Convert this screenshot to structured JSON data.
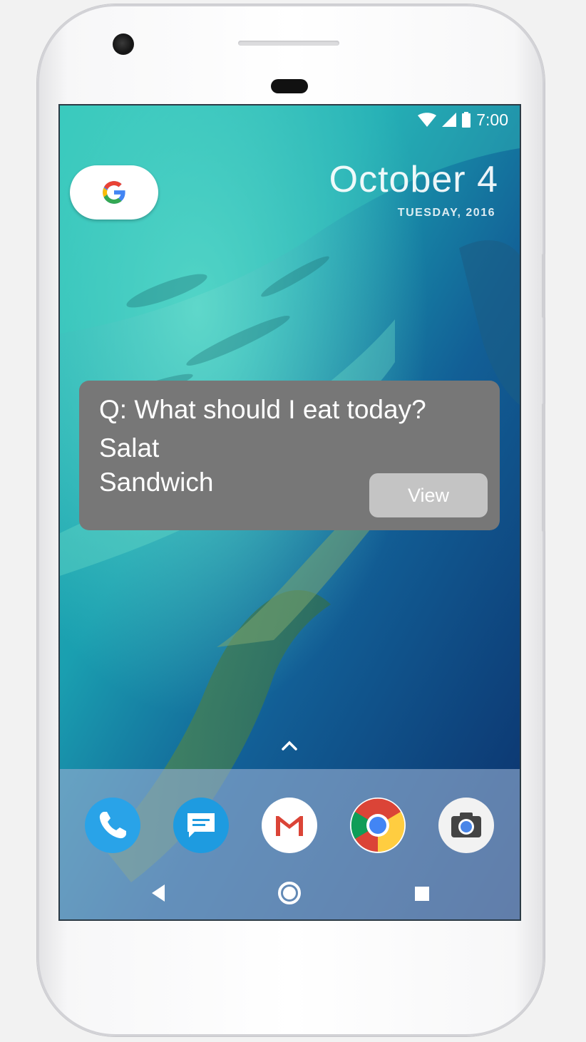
{
  "status_bar": {
    "time": "7:00"
  },
  "widget": {
    "date": "October 4",
    "weekday_year": "TUESDAY, 2016"
  },
  "notification": {
    "question": "Q: What should I eat today?",
    "options": [
      "Salat",
      "Sandwich"
    ],
    "action_label": "View"
  },
  "dock": {
    "apps": [
      "phone-icon",
      "messages-icon",
      "gmail-icon",
      "chrome-icon",
      "camera-icon"
    ]
  },
  "colors": {
    "notification_bg": "#777777",
    "view_button_bg": "#c4c4c4",
    "google_blue": "#4285F4",
    "google_red": "#EA4335",
    "google_yellow": "#FBBC05",
    "google_green": "#34A853"
  }
}
